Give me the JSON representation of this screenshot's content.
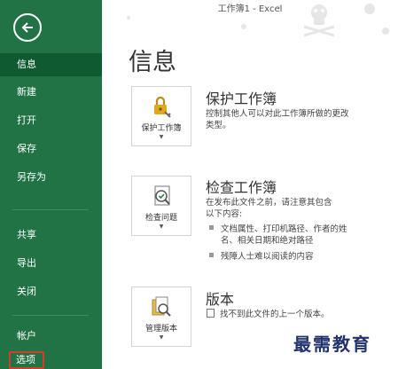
{
  "window": {
    "title": "工作簿1 - Excel"
  },
  "sidebar": {
    "items": [
      {
        "label": "信息"
      },
      {
        "label": "新建"
      },
      {
        "label": "打开"
      },
      {
        "label": "保存"
      },
      {
        "label": "另存为"
      },
      {
        "label": "共享"
      },
      {
        "label": "导出"
      },
      {
        "label": "关闭"
      },
      {
        "label": "帐户"
      },
      {
        "label": "选项"
      }
    ]
  },
  "main": {
    "page_title": "信息",
    "sections": [
      {
        "button_label": "保护工作簿",
        "title": "保护工作簿",
        "desc_lines": [
          "控制其他人可以对此工作簿所做的更改",
          "类型。"
        ]
      },
      {
        "button_label": "检查问题",
        "title": "检查工作簿",
        "desc_lines": [
          "在发布此文件之前，请注意其包含",
          "以下内容:"
        ],
        "bullets": [
          [
            "文档属性、打印机路径、作者的姓",
            "名、相关日期和绝对路径"
          ],
          [
            "残障人士难以阅读的内容"
          ]
        ]
      },
      {
        "button_label": "管理版本",
        "title": "版本",
        "desc_lines": [
          "找不到此文件的上一个版本。"
        ]
      }
    ]
  },
  "watermark": "最需教育",
  "colors": {
    "sidebar": "#217346",
    "selected": "#0f5a30",
    "highlight": "#d93a2a"
  }
}
